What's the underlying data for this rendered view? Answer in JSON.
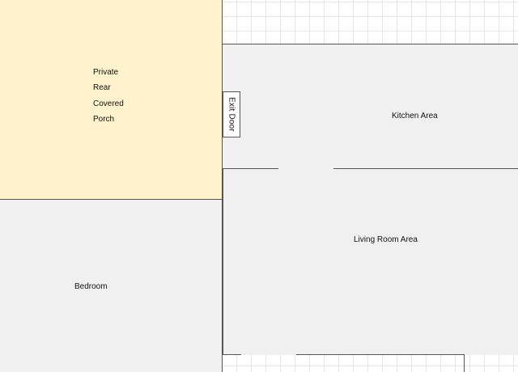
{
  "rooms": {
    "porch": {
      "label_lines": [
        "Private",
        "Rear",
        "Covered",
        "Porch"
      ],
      "fill": "#fff2cc"
    },
    "kitchen": {
      "label": "Kitchen Area",
      "fill": "#f0f0f0"
    },
    "living": {
      "label": "Living Room Area",
      "fill": "#f0f0f0"
    },
    "bedroom": {
      "label": "Bedroom",
      "fill": "#f0f0f0"
    }
  },
  "exit_door": {
    "label": "Exit Door"
  },
  "colors": {
    "wall": "#555555",
    "grid": "#e6e6e6",
    "canvas": "#ffffff"
  }
}
